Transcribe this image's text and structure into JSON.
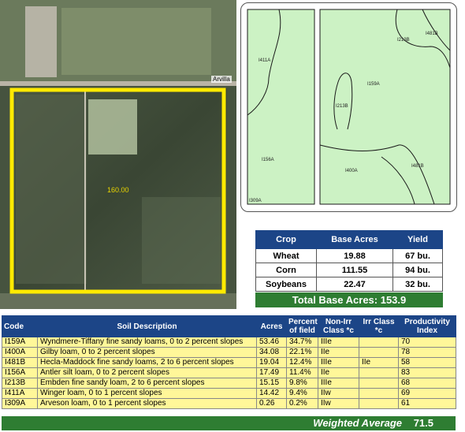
{
  "aerial": {
    "road_label": "Arvilla",
    "acres_label": "160.00"
  },
  "soil_map": {
    "units": [
      {
        "label": "I411A"
      },
      {
        "label": "I156A"
      },
      {
        "label": "I213B"
      },
      {
        "label": "I481B"
      },
      {
        "label": "I159A"
      },
      {
        "label": "I213B"
      },
      {
        "label": "I400A"
      },
      {
        "label": "I481B"
      },
      {
        "label": "I309A"
      }
    ],
    "colors": {
      "fill": "#ccf2c4",
      "line": "#1a1a1a"
    }
  },
  "crop_table": {
    "headers": [
      "Crop",
      "Base Acres",
      "Yield"
    ],
    "rows": [
      {
        "crop": "Wheat",
        "base_acres": "19.88",
        "yield": "67 bu."
      },
      {
        "crop": "Corn",
        "base_acres": "111.55",
        "yield": "94 bu."
      },
      {
        "crop": "Soybeans",
        "base_acres": "22.47",
        "yield": "32 bu."
      }
    ],
    "total": "Total Base Acres:  153.9"
  },
  "soil_table": {
    "headers": {
      "code": "Code",
      "desc": "Soil Description",
      "acres": "Acres",
      "pct": "Percent of field",
      "nonirr": "Non-Irr Class *c",
      "irr": "Irr Class *c",
      "prod": "Productivity Index"
    },
    "rows": [
      {
        "code": "I159A",
        "desc": "Wyndmere-Tiffany fine sandy loams, 0 to 2 percent slopes",
        "acres": "53.46",
        "pct": "34.7%",
        "nonirr": "IIIe",
        "irr": "",
        "prod": "70"
      },
      {
        "code": "I400A",
        "desc": "Gilby loam, 0 to 2 percent slopes",
        "acres": "34.08",
        "pct": "22.1%",
        "nonirr": "IIe",
        "irr": "",
        "prod": "78"
      },
      {
        "code": "I481B",
        "desc": "Hecla-Maddock fine sandy loams, 2 to 6 percent slopes",
        "acres": "19.04",
        "pct": "12.4%",
        "nonirr": "IIIe",
        "irr": "IIe",
        "prod": "58"
      },
      {
        "code": "I156A",
        "desc": "Antler silt loam, 0 to 2 percent slopes",
        "acres": "17.49",
        "pct": "11.4%",
        "nonirr": "IIe",
        "irr": "",
        "prod": "83"
      },
      {
        "code": "I213B",
        "desc": "Embden fine sandy loam, 2 to 6 percent slopes",
        "acres": "15.15",
        "pct": "9.8%",
        "nonirr": "IIIe",
        "irr": "",
        "prod": "68"
      },
      {
        "code": "I411A",
        "desc": "Winger loam, 0 to 1 percent slopes",
        "acres": "14.42",
        "pct": "9.4%",
        "nonirr": "IIw",
        "irr": "",
        "prod": "69"
      },
      {
        "code": "I309A",
        "desc": "Arveson loam, 0 to 1 percent slopes",
        "acres": "0.26",
        "pct": "0.2%",
        "nonirr": "IIw",
        "irr": "",
        "prod": "61"
      }
    ],
    "weighted_average_label": "Weighted Average",
    "weighted_average_value": "71.5"
  }
}
